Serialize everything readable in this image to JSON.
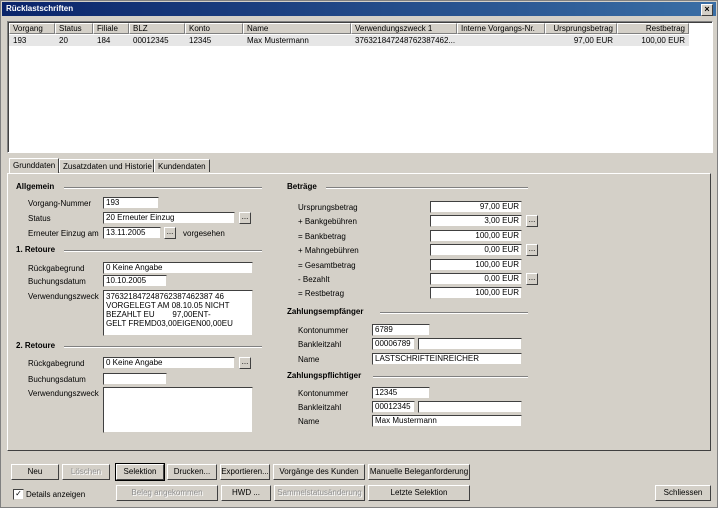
{
  "window": {
    "title": "Rücklastschriften",
    "close_glyph": "×"
  },
  "list": {
    "columns": [
      "Vorgang",
      "Status",
      "Filiale",
      "BLZ",
      "Konto",
      "Name",
      "Verwendungszweck 1",
      "Interne Vorgangs-Nr.",
      "Ursprungsbetrag",
      "Restbetrag"
    ],
    "rows": [
      {
        "vorgang": "193",
        "status": "20",
        "filiale": "184",
        "blz": "00012345",
        "konto": "12345",
        "name": "Max Mustermann",
        "verwendungszweck": "376321847248762387462...",
        "interne_nr": "",
        "ursprungsbetrag": "97,00 EUR",
        "restbetrag": "100,00 EUR"
      }
    ]
  },
  "tabs": [
    "Grunddaten",
    "Zusatzdaten und Historie",
    "Kundendaten"
  ],
  "allgemein": {
    "heading": "Allgemein",
    "vorgang_label": "Vorgang-Nummer",
    "vorgang_value": "193",
    "status_label": "Status",
    "status_value": "20 Erneuter Einzug",
    "einzug_label": "Erneuter Einzug am",
    "einzug_value": "13.11.2005",
    "einzug_note": "vorgesehen"
  },
  "retoure1": {
    "heading": "1. Retoure",
    "grund_label": "Rückgabegrund",
    "grund_value": "0 Keine Angabe",
    "buchung_label": "Buchungsdatum",
    "buchung_value": "10.10.2005",
    "zweck_label": "Verwendungszweck",
    "zweck_value": "376321847248762387462387 46\nVORGELEGT AM 08.10.05 NICHT\nBEZAHLT EU        97,00ENT-\nGELT FREMD03,00EIGEN00,00EU"
  },
  "retoure2": {
    "heading": "2. Retoure",
    "grund_label": "Rückgabegrund",
    "grund_value": "0 Keine Angabe",
    "buchung_label": "Buchungsdatum",
    "buchung_value": "",
    "zweck_label": "Verwendungszweck",
    "zweck_value": ""
  },
  "betraege": {
    "heading": "Beträge",
    "items": [
      {
        "label": "Ursprungsbetrag",
        "value": "97,00 EUR"
      },
      {
        "label": "+ Bankgebühren",
        "value": "3,00 EUR"
      },
      {
        "label": "= Bankbetrag",
        "value": "100,00 EUR"
      },
      {
        "label": "+ Mahngebühren",
        "value": "0,00 EUR"
      },
      {
        "label": "= Gesamtbetrag",
        "value": "100,00 EUR"
      },
      {
        "label": "- Bezahlt",
        "value": "0,00 EUR"
      },
      {
        "label": "= Restbetrag",
        "value": "100,00 EUR"
      }
    ]
  },
  "empfaenger": {
    "heading": "Zahlungsempfänger",
    "konto_label": "Kontonummer",
    "konto_value": "6789",
    "blz_label": "Bankleitzahl",
    "blz_value": "00006789",
    "blz_name": "",
    "name_label": "Name",
    "name_value": "LASTSCHRIFTEINREICHER"
  },
  "pflichtiger": {
    "heading": "Zahlungspflichtiger",
    "konto_label": "Kontonummer",
    "konto_value": "12345",
    "blz_label": "Bankleitzahl",
    "blz_value": "00012345",
    "blz_name": "",
    "name_label": "Name",
    "name_value": "Max Mustermann"
  },
  "dots_label": "...",
  "buttons": {
    "neu": "Neu",
    "loeschen": "Löschen",
    "selektion": "Selektion",
    "drucken": "Drucken...",
    "exportieren": "Exportieren...",
    "vorgaenge": "Vorgänge des Kunden",
    "manuelle": "Manuelle Beleganforderung",
    "beleg": "Beleg angekommen",
    "hwd": "HWD ...",
    "sammel": "Sammelstatusänderung",
    "letzte": "Letzte Selektion",
    "schliessen": "Schliessen"
  },
  "details": {
    "label": "Details anzeigen",
    "checked": true,
    "check_glyph": "✓"
  }
}
